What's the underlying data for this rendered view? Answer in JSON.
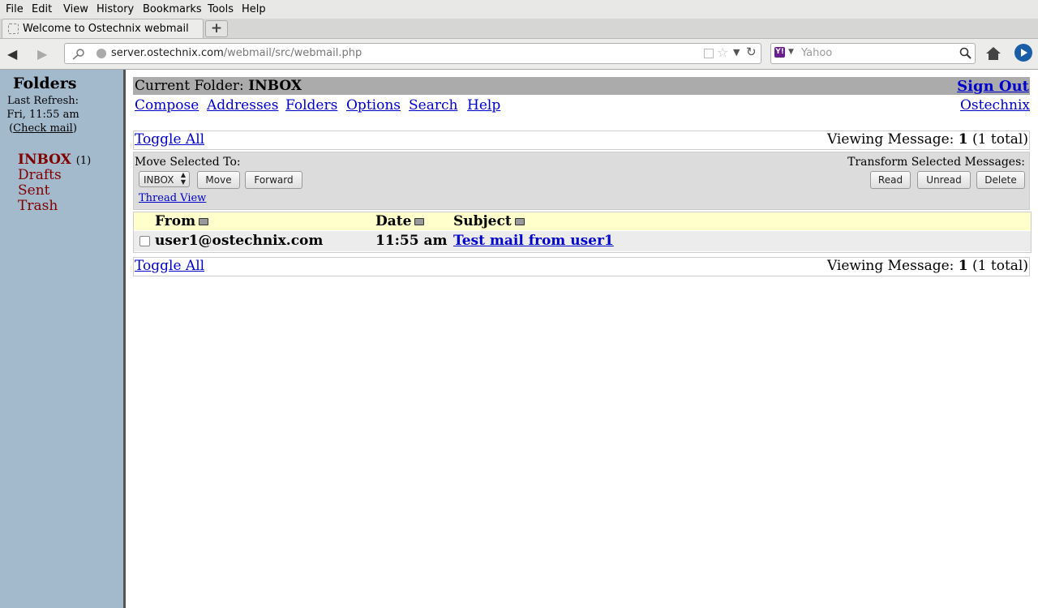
{
  "browser": {
    "menu": [
      "File",
      "Edit",
      "View",
      "History",
      "Bookmarks",
      "Tools",
      "Help"
    ],
    "tab_title": "Welcome to Ostechnix webmail",
    "new_tab_label": "+",
    "url_host": "server.ostechnix.com",
    "url_path": "/webmail/src/webmail.php",
    "search_placeholder": "Yahoo"
  },
  "sidebar": {
    "title": "Folders",
    "last_refresh_label": "Last Refresh:",
    "last_refresh_time": "Fri, 11:55 am",
    "check_mail_open": "(",
    "check_mail": "Check mail",
    "check_mail_close": ")",
    "folders": [
      {
        "name": "INBOX",
        "count": "(1)"
      },
      {
        "name": "Drafts",
        "count": ""
      },
      {
        "name": "Sent",
        "count": ""
      },
      {
        "name": "Trash",
        "count": ""
      }
    ]
  },
  "header": {
    "current_folder_label": "Current Folder:",
    "current_folder": "INBOX",
    "sign_out": "Sign Out",
    "org_link": "Ostechnix",
    "nav": [
      "Compose",
      "Addresses",
      "Folders",
      "Options",
      "Search",
      "Help"
    ]
  },
  "list": {
    "toggle_all": "Toggle All",
    "viewing_label": "Viewing Message:",
    "viewing_num": "1",
    "viewing_total": "(1 total)",
    "move_label": "Move Selected To:",
    "move_select_value": "INBOX",
    "move_button": "Move",
    "forward_button": "Forward",
    "thread_view": "Thread View",
    "transform_label": "Transform Selected Messages:",
    "read_button": "Read",
    "unread_button": "Unread",
    "delete_button": "Delete",
    "columns": {
      "from": "From",
      "date": "Date",
      "subject": "Subject"
    },
    "messages": [
      {
        "from": "user1@ostechnix.com",
        "date": "11:55 am",
        "subject": "Test mail from user1"
      }
    ]
  }
}
